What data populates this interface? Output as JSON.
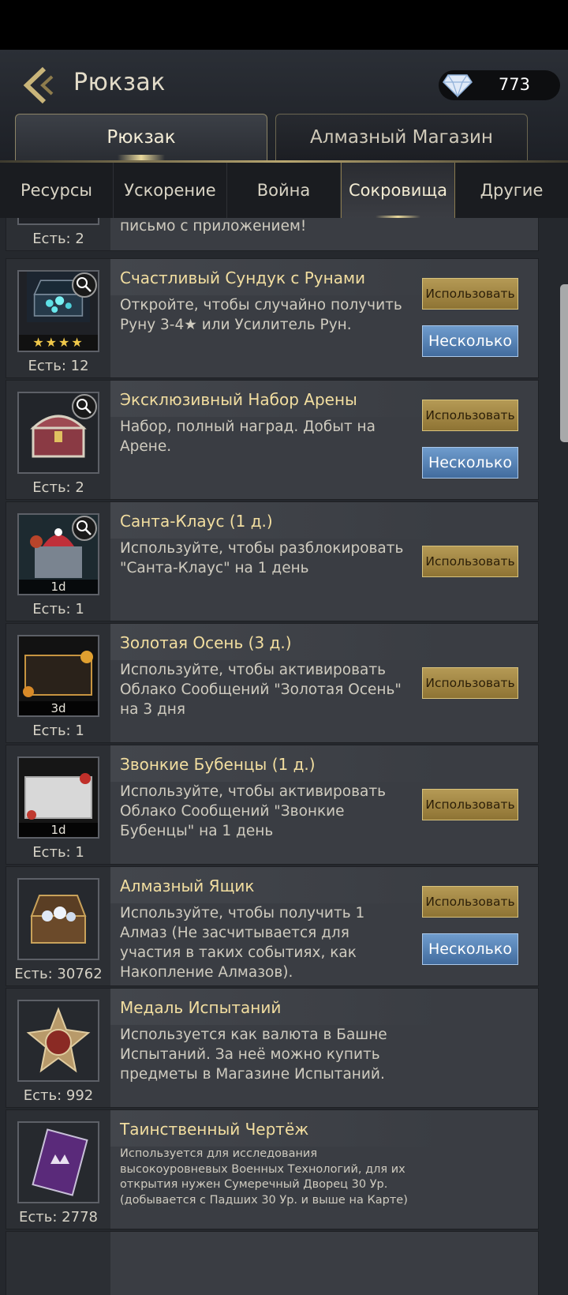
{
  "header": {
    "title": "Рюкзак",
    "gems": "773"
  },
  "main_tabs": [
    {
      "label": "Рюкзак",
      "active": true
    },
    {
      "label": "Алмазный Магазин",
      "active": false
    }
  ],
  "sub_tabs": [
    {
      "label": "Ресурсы"
    },
    {
      "label": "Ускорение"
    },
    {
      "label": "Война"
    },
    {
      "label": "Сокровища",
      "active": true
    },
    {
      "label": "Другие"
    }
  ],
  "buttons": {
    "use": "Использовать",
    "multi": "Несколько"
  },
  "items": [
    {
      "name": "",
      "desc": "письмо с приложением!",
      "count": "Есть: 2"
    },
    {
      "name": "Счастливый Сундук с Рунами",
      "desc": "Откройте, чтобы случайно получить Руну 3-4★ или Усилитель Рун.",
      "count": "Есть: 12",
      "badge": "★★★★"
    },
    {
      "name": "Эксклюзивный Набор Арены",
      "desc": "Набор, полный наград. Добыт на Арене.",
      "count": "Есть: 2"
    },
    {
      "name": "Санта-Клаус (1 д.)",
      "desc": "Используйте, чтобы разблокировать \"Санта-Клаус\" на 1 день",
      "count": "Есть: 1",
      "badge": "1d"
    },
    {
      "name": "Золотая Осень (3 д.)",
      "desc": "Используйте, чтобы активировать Облако Сообщений \"Золотая Осень\" на 3 дня",
      "count": "Есть: 1",
      "badge": "3d"
    },
    {
      "name": "Звонкие Бубенцы (1 д.)",
      "desc": "Используйте, чтобы активировать Облако Сообщений \"Звонкие Бубенцы\" на 1 день",
      "count": "Есть: 1",
      "badge": "1d"
    },
    {
      "name": "Алмазный Ящик",
      "desc": "Используйте, чтобы получить 1 Алмаз (Не засчитывается для участия в таких событиях, как Накопление Алмазов).",
      "count": "Есть: 30762"
    },
    {
      "name": "Медаль Испытаний",
      "desc": "Используется как валюта в Башне Испытаний. За неё можно купить предметы в Магазине Испытаний.",
      "count": "Есть: 992"
    },
    {
      "name": "Таинственный Чертёж",
      "desc": "Используется для исследования высокоуровневых Военных Технологий, для их открытия нужен Сумеречный Дворец 30 Ур. (добывается с Падших 30 Ур. и выше на Карте)",
      "count": "Есть: 2778"
    }
  ]
}
